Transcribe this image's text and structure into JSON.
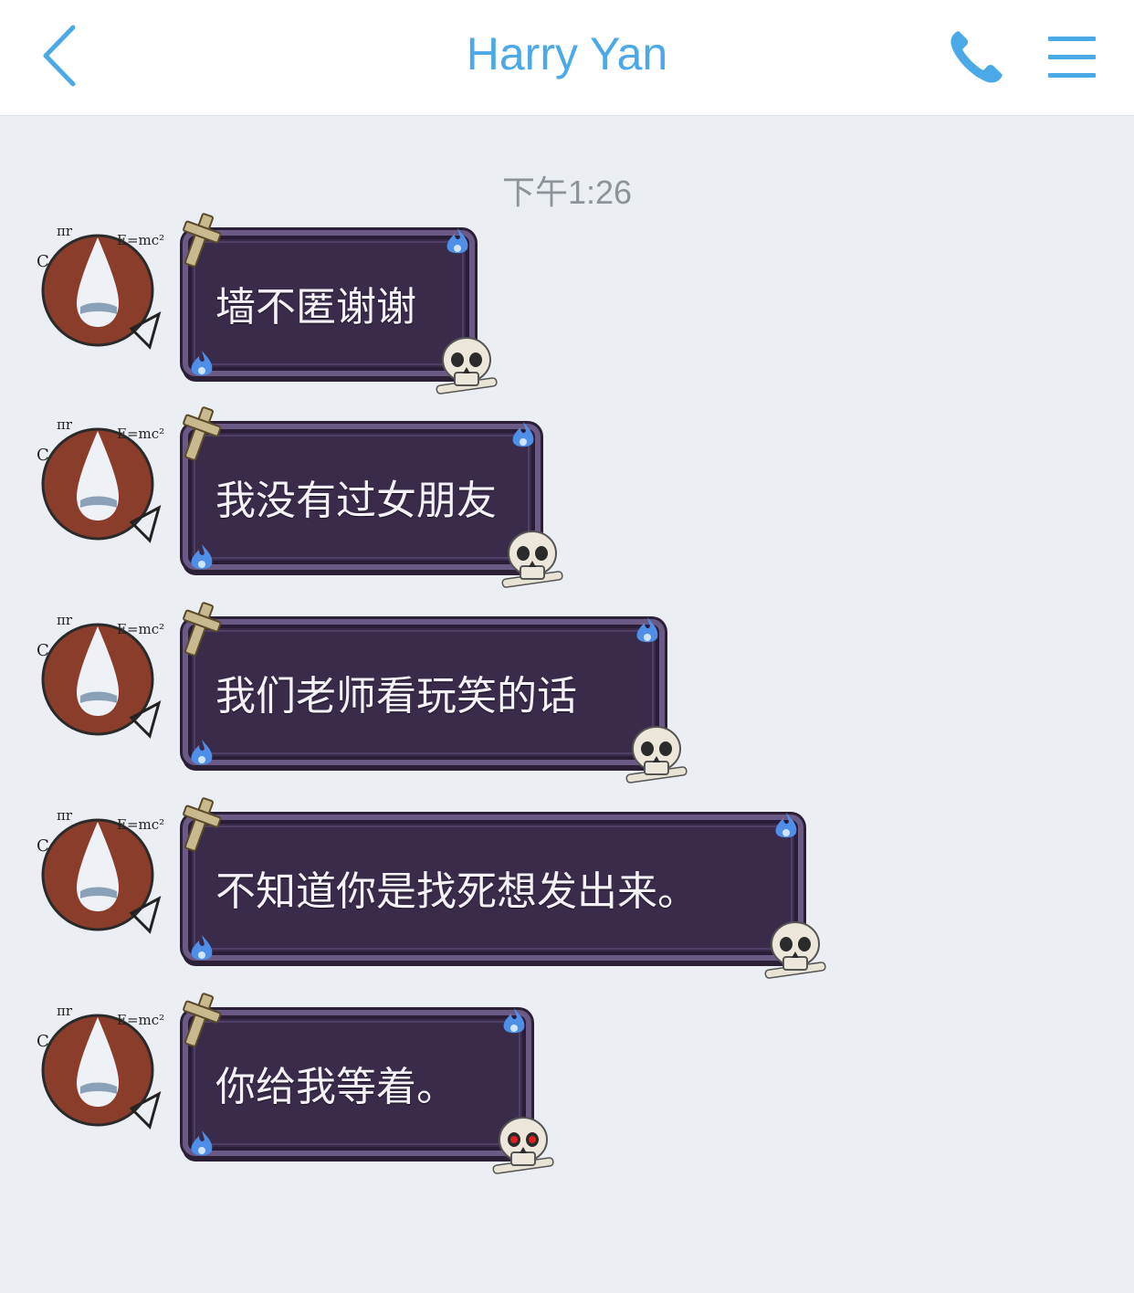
{
  "header": {
    "title": "Harry Yan",
    "accent": "#4aa9e6"
  },
  "timestamp": "下午1:26",
  "messages": [
    {
      "text": "墙不匿谢谢",
      "skull": "normal"
    },
    {
      "text": "我没有过女朋友",
      "skull": "normal"
    },
    {
      "text": "我们老师看玩笑的话",
      "skull": "normal"
    },
    {
      "text": "不知道你是找死想发出来。",
      "skull": "normal"
    },
    {
      "text": "你给我等着。",
      "skull": "red-eyes"
    }
  ],
  "icons": {
    "back": "chevron-left-icon",
    "call": "phone-icon",
    "menu": "hamburger-menu-icon",
    "bubble_decor": [
      "cross-icon",
      "blue-flame-icon",
      "skull-icon"
    ]
  },
  "colors": {
    "background": "#ebeef3",
    "bubble_fill": "#3a2b4b",
    "bubble_border": "#6b5a86",
    "text": "#f4f2f7"
  }
}
